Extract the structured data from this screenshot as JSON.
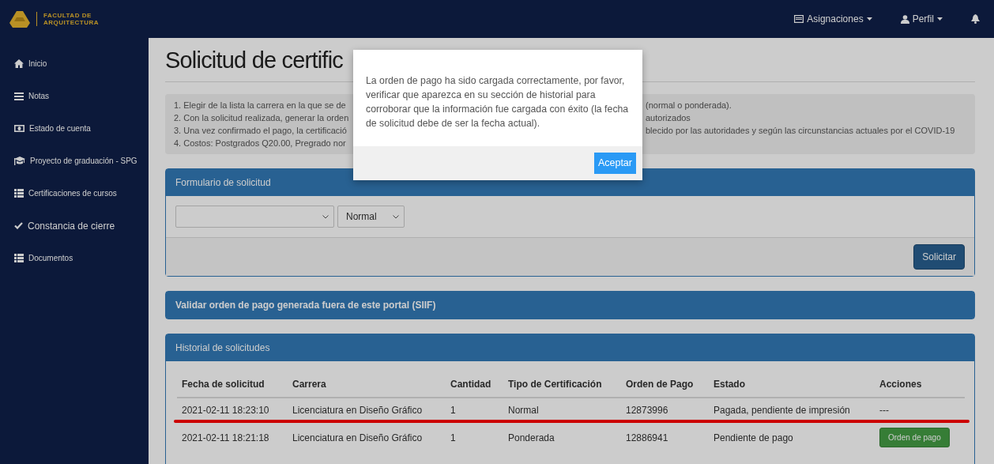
{
  "navbar": {
    "logo_text": [
      "FACULTAD DE",
      "ARQUITECTURA"
    ],
    "menus": [
      {
        "label": "Asignaciones",
        "dropdown": true
      },
      {
        "label": "Perfil",
        "dropdown": true
      }
    ]
  },
  "sidebar": {
    "items": [
      {
        "label": "Inicio"
      },
      {
        "label": "Notas"
      },
      {
        "label": "Estado de cuenta"
      },
      {
        "label": "Proyecto de graduación - SPG"
      },
      {
        "label": "Certificaciones de cursos"
      },
      {
        "label": "Constancia de cierre"
      },
      {
        "label": "Documentos"
      }
    ]
  },
  "page": {
    "title": "Solicitud de certific",
    "instructions": [
      {
        "left": "1. Elegir de la lista la carrera en la que se de",
        "right": "(normal o ponderada)."
      },
      {
        "left": "2. Con la solicitud realizada, generar la orden",
        "right": "autorizados"
      },
      {
        "left": "3. Una vez confirmado el pago, la certificació",
        "right": "blecido por las autoridades y según las circunstancias actuales por el COVID-19"
      },
      {
        "left": "4. Costos: Postgrados Q20.00, Pregrado nor"
      }
    ]
  },
  "form_panel": {
    "title": "Formulario de solicitud",
    "selects": [
      {
        "kind": "blank"
      },
      {
        "kind": "filled",
        "value": "Normal"
      }
    ],
    "button": "Solicitar"
  },
  "validate_panel": {
    "title": "Validar orden de pago generada fuera de este portal (SIIF)"
  },
  "history_panel": {
    "title": "Historial de solicitudes",
    "columns": [
      "Fecha de solicitud",
      "Carrera",
      "Cantidad",
      "Tipo de Certificación",
      "Orden de Pago",
      "Estado",
      "Acciones"
    ],
    "rows": [
      {
        "cells": [
          "2021-02-11 18:23:10",
          "Licenciatura en Diseño Gráfico",
          "1",
          "Normal",
          "12873996",
          "Pagada, pendiente de impresión"
        ],
        "action": {
          "kind": "text",
          "label": "---"
        },
        "underlined": true
      },
      {
        "cells": [
          "2021-02-11 18:21:18",
          "Licenciatura en Diseño Gráfico",
          "1",
          "Ponderada",
          "12886941",
          "Pendiente de pago"
        ],
        "action": {
          "kind": "button",
          "label": "Orden de pago"
        },
        "underlined": false
      }
    ]
  },
  "modal": {
    "message": "La orden de pago ha sido cargada correctamente, por favor, verificar que aparezca en su sección de historial para corroborar que la información fue cargada con éxito (la fecha de solicitud debe de ser la fecha actual).",
    "button": "Aceptar"
  }
}
